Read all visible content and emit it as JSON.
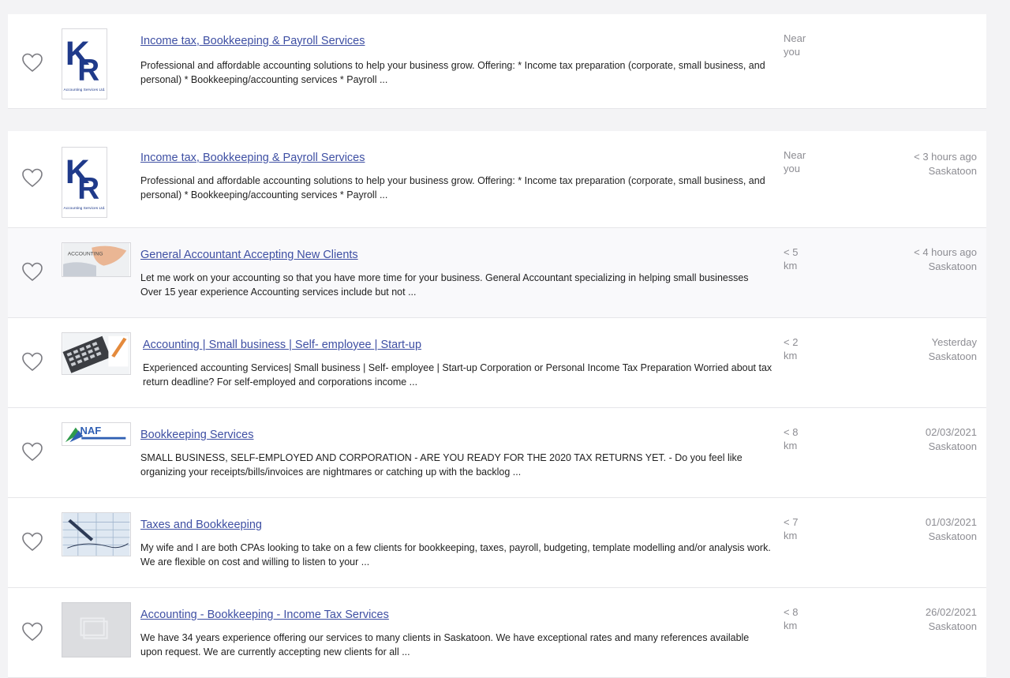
{
  "listings": [
    {
      "title": "Income tax, Bookkeeping & Payroll Services",
      "description": "Professional and affordable accounting solutions to help your business grow. Offering: * Income tax preparation (corporate, small business, and personal) * Bookkeeping/accounting services * Payroll ...",
      "distance_value": "Near",
      "distance_unit": "you",
      "posted": "",
      "location": "",
      "thumb_text": "Accounting Services Ltd."
    },
    {
      "title": "Income tax, Bookkeeping & Payroll Services",
      "description": "Professional and affordable accounting solutions to help your business grow. Offering: * Income tax preparation (corporate, small business, and personal) * Bookkeeping/accounting services * Payroll ...",
      "distance_value": "Near",
      "distance_unit": "you",
      "posted": "< 3 hours ago",
      "location": "Saskatoon",
      "thumb_text": "Accounting Services Ltd."
    },
    {
      "title": "General Accountant Accepting New Clients",
      "description": "Let me work on your accounting so that you have more time for your business. General Accountant specializing in helping small businesses Over 15 year experience Accounting services include but not ...",
      "distance_value": "< 5",
      "distance_unit": "km",
      "posted": "< 4 hours ago",
      "location": "Saskatoon",
      "thumb_text": "ACCOUNTING"
    },
    {
      "title": "Accounting | Small business | Self- employee | Start-up",
      "description": "Experienced accounting Services| Small business | Self- employee | Start-up Corporation or Personal Income Tax Preparation Worried about tax return deadline? For self-employed and corporations income ...",
      "distance_value": "< 2",
      "distance_unit": "km",
      "posted": "Yesterday",
      "location": "Saskatoon",
      "thumb_text": ""
    },
    {
      "title": "Bookkeeping Services",
      "description": "SMALL BUSINESS, SELF-EMPLOYED AND CORPORATION - ARE YOU READY FOR THE 2020 TAX RETURNS YET. - Do you feel like organizing your receipts/bills/invoices are nightmares or catching up with the backlog ...",
      "distance_value": "< 8",
      "distance_unit": "km",
      "posted": "02/03/2021",
      "location": "Saskatoon",
      "thumb_text": "NAF"
    },
    {
      "title": "Taxes and Bookkeeping",
      "description": "My wife and I are both CPAs looking to take on a few clients for bookkeeping, taxes, payroll, budgeting, template modelling and/or analysis work. We are flexible on cost and willing to listen to your ...",
      "distance_value": "< 7",
      "distance_unit": "km",
      "posted": "01/03/2021",
      "location": "Saskatoon",
      "thumb_text": ""
    },
    {
      "title": "Accounting - Bookkeeping - Income Tax Services",
      "description": "We have 34 years experience offering our services to many clients in Saskatoon. We have exceptional rates and many references available upon request. We are currently accepting new clients for all ...",
      "distance_value": "< 8",
      "distance_unit": "km",
      "posted": "26/02/2021",
      "location": "Saskatoon",
      "thumb_text": ""
    }
  ],
  "icons": {
    "favorite": "heart-outline-icon",
    "placeholder": "image-placeholder-icon"
  },
  "colors": {
    "link": "#3e4fa3",
    "muted": "#8d8d93",
    "kr_logo": "#1f3a8a",
    "naf_logo": "#2f5fb3"
  }
}
